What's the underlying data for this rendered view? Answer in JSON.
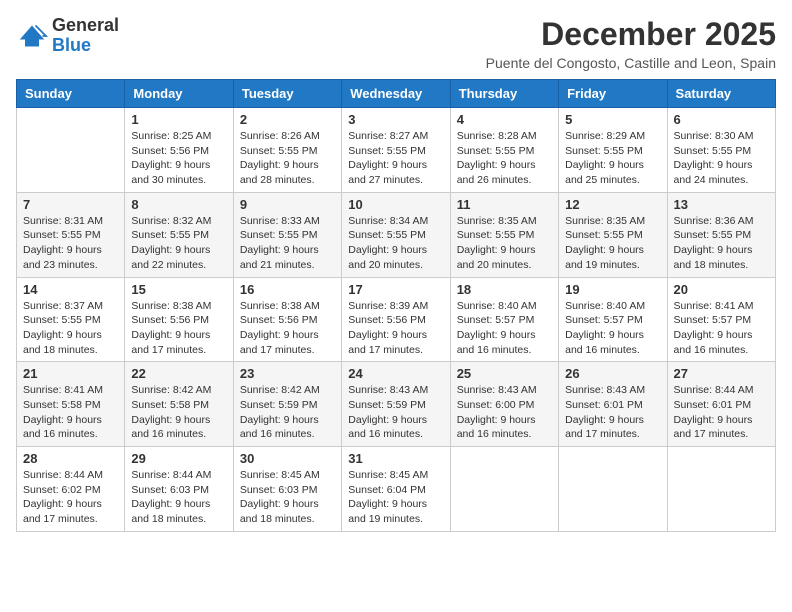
{
  "header": {
    "logo_general": "General",
    "logo_blue": "Blue",
    "month_title": "December 2025",
    "location": "Puente del Congosto, Castille and Leon, Spain"
  },
  "calendar": {
    "columns": [
      "Sunday",
      "Monday",
      "Tuesday",
      "Wednesday",
      "Thursday",
      "Friday",
      "Saturday"
    ],
    "weeks": [
      [
        {
          "day": "",
          "info": ""
        },
        {
          "day": "1",
          "info": "Sunrise: 8:25 AM\nSunset: 5:56 PM\nDaylight: 9 hours\nand 30 minutes."
        },
        {
          "day": "2",
          "info": "Sunrise: 8:26 AM\nSunset: 5:55 PM\nDaylight: 9 hours\nand 28 minutes."
        },
        {
          "day": "3",
          "info": "Sunrise: 8:27 AM\nSunset: 5:55 PM\nDaylight: 9 hours\nand 27 minutes."
        },
        {
          "day": "4",
          "info": "Sunrise: 8:28 AM\nSunset: 5:55 PM\nDaylight: 9 hours\nand 26 minutes."
        },
        {
          "day": "5",
          "info": "Sunrise: 8:29 AM\nSunset: 5:55 PM\nDaylight: 9 hours\nand 25 minutes."
        },
        {
          "day": "6",
          "info": "Sunrise: 8:30 AM\nSunset: 5:55 PM\nDaylight: 9 hours\nand 24 minutes."
        }
      ],
      [
        {
          "day": "7",
          "info": "Sunrise: 8:31 AM\nSunset: 5:55 PM\nDaylight: 9 hours\nand 23 minutes."
        },
        {
          "day": "8",
          "info": "Sunrise: 8:32 AM\nSunset: 5:55 PM\nDaylight: 9 hours\nand 22 minutes."
        },
        {
          "day": "9",
          "info": "Sunrise: 8:33 AM\nSunset: 5:55 PM\nDaylight: 9 hours\nand 21 minutes."
        },
        {
          "day": "10",
          "info": "Sunrise: 8:34 AM\nSunset: 5:55 PM\nDaylight: 9 hours\nand 20 minutes."
        },
        {
          "day": "11",
          "info": "Sunrise: 8:35 AM\nSunset: 5:55 PM\nDaylight: 9 hours\nand 20 minutes."
        },
        {
          "day": "12",
          "info": "Sunrise: 8:35 AM\nSunset: 5:55 PM\nDaylight: 9 hours\nand 19 minutes."
        },
        {
          "day": "13",
          "info": "Sunrise: 8:36 AM\nSunset: 5:55 PM\nDaylight: 9 hours\nand 18 minutes."
        }
      ],
      [
        {
          "day": "14",
          "info": "Sunrise: 8:37 AM\nSunset: 5:55 PM\nDaylight: 9 hours\nand 18 minutes."
        },
        {
          "day": "15",
          "info": "Sunrise: 8:38 AM\nSunset: 5:56 PM\nDaylight: 9 hours\nand 17 minutes."
        },
        {
          "day": "16",
          "info": "Sunrise: 8:38 AM\nSunset: 5:56 PM\nDaylight: 9 hours\nand 17 minutes."
        },
        {
          "day": "17",
          "info": "Sunrise: 8:39 AM\nSunset: 5:56 PM\nDaylight: 9 hours\nand 17 minutes."
        },
        {
          "day": "18",
          "info": "Sunrise: 8:40 AM\nSunset: 5:57 PM\nDaylight: 9 hours\nand 16 minutes."
        },
        {
          "day": "19",
          "info": "Sunrise: 8:40 AM\nSunset: 5:57 PM\nDaylight: 9 hours\nand 16 minutes."
        },
        {
          "day": "20",
          "info": "Sunrise: 8:41 AM\nSunset: 5:57 PM\nDaylight: 9 hours\nand 16 minutes."
        }
      ],
      [
        {
          "day": "21",
          "info": "Sunrise: 8:41 AM\nSunset: 5:58 PM\nDaylight: 9 hours\nand 16 minutes."
        },
        {
          "day": "22",
          "info": "Sunrise: 8:42 AM\nSunset: 5:58 PM\nDaylight: 9 hours\nand 16 minutes."
        },
        {
          "day": "23",
          "info": "Sunrise: 8:42 AM\nSunset: 5:59 PM\nDaylight: 9 hours\nand 16 minutes."
        },
        {
          "day": "24",
          "info": "Sunrise: 8:43 AM\nSunset: 5:59 PM\nDaylight: 9 hours\nand 16 minutes."
        },
        {
          "day": "25",
          "info": "Sunrise: 8:43 AM\nSunset: 6:00 PM\nDaylight: 9 hours\nand 16 minutes."
        },
        {
          "day": "26",
          "info": "Sunrise: 8:43 AM\nSunset: 6:01 PM\nDaylight: 9 hours\nand 17 minutes."
        },
        {
          "day": "27",
          "info": "Sunrise: 8:44 AM\nSunset: 6:01 PM\nDaylight: 9 hours\nand 17 minutes."
        }
      ],
      [
        {
          "day": "28",
          "info": "Sunrise: 8:44 AM\nSunset: 6:02 PM\nDaylight: 9 hours\nand 17 minutes."
        },
        {
          "day": "29",
          "info": "Sunrise: 8:44 AM\nSunset: 6:03 PM\nDaylight: 9 hours\nand 18 minutes."
        },
        {
          "day": "30",
          "info": "Sunrise: 8:45 AM\nSunset: 6:03 PM\nDaylight: 9 hours\nand 18 minutes."
        },
        {
          "day": "31",
          "info": "Sunrise: 8:45 AM\nSunset: 6:04 PM\nDaylight: 9 hours\nand 19 minutes."
        },
        {
          "day": "",
          "info": ""
        },
        {
          "day": "",
          "info": ""
        },
        {
          "day": "",
          "info": ""
        }
      ]
    ]
  }
}
